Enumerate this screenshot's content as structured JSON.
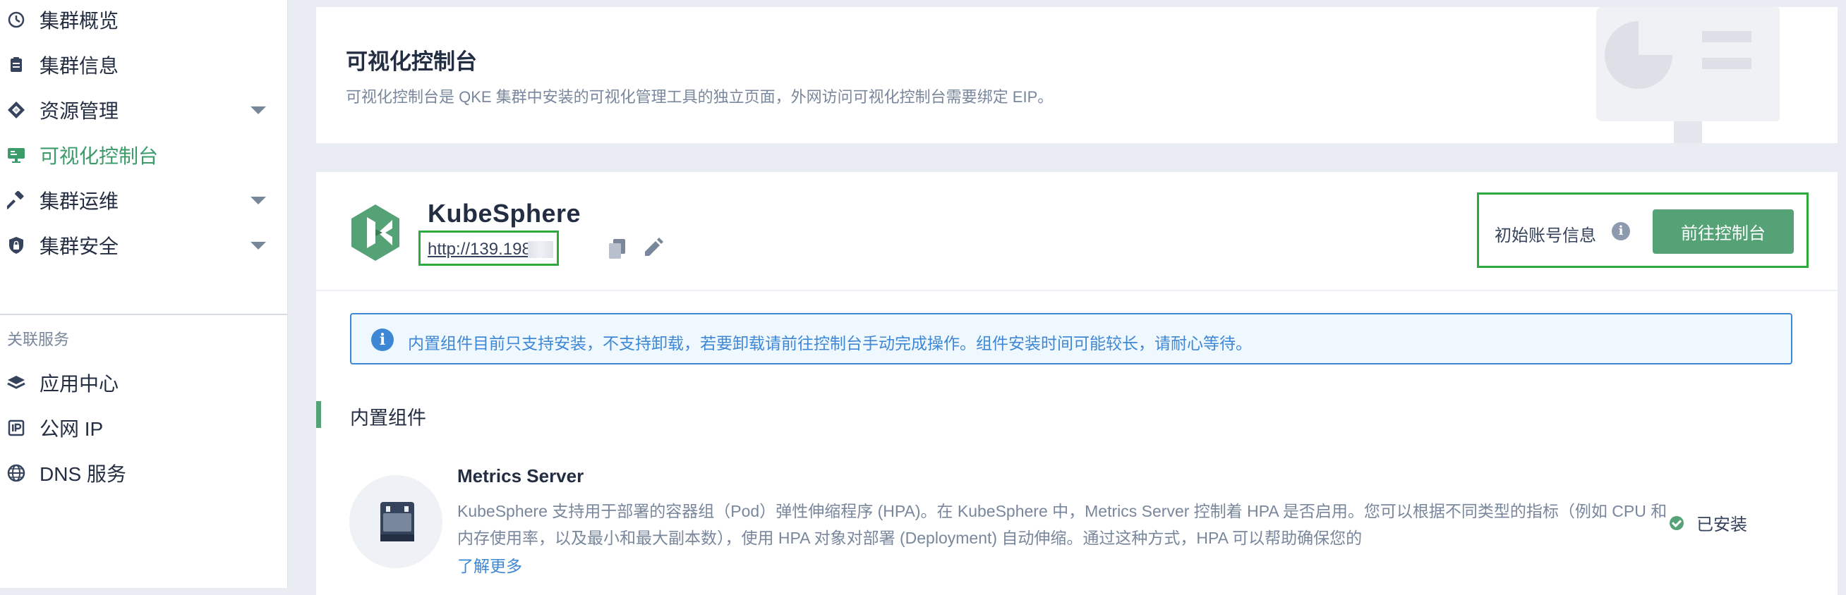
{
  "sidebar": {
    "items": [
      {
        "label": "集群概览",
        "icon": "dashboard-icon",
        "has_submenu": false,
        "active": false
      },
      {
        "label": "集群信息",
        "icon": "clipboard-icon",
        "has_submenu": false,
        "active": false
      },
      {
        "label": "资源管理",
        "icon": "resources-icon",
        "has_submenu": true,
        "active": false
      },
      {
        "label": "可视化控制台",
        "icon": "monitor-icon",
        "has_submenu": false,
        "active": true
      },
      {
        "label": "集群运维",
        "icon": "hammer-icon",
        "has_submenu": true,
        "active": false
      },
      {
        "label": "集群安全",
        "icon": "shield-lock-icon",
        "has_submenu": true,
        "active": false
      }
    ],
    "related_title": "关联服务",
    "related_items": [
      {
        "label": "应用中心",
        "icon": "layers-icon"
      },
      {
        "label": "公网 IP",
        "icon": "ip-icon"
      },
      {
        "label": "DNS 服务",
        "icon": "globe-icon"
      }
    ]
  },
  "header": {
    "title": "可视化控制台",
    "description": "可视化控制台是 QKE 集群中安装的可视化管理工具的独立页面，外网访问可视化控制台需要绑定 EIP。"
  },
  "console": {
    "app_name": "KubeSphere",
    "url": "http://139.198.",
    "account_label": "初始账号信息",
    "go_button": "前往控制台"
  },
  "notice": {
    "icon": "info-icon",
    "text": "内置组件目前只支持安装，不支持卸载，若要卸载请前往控制台手动完成操作。组件安装时间可能较长，请耐心等待。"
  },
  "builtin": {
    "title": "内置组件",
    "components": [
      {
        "name": "Metrics Server",
        "description": "KubeSphere 支持用于部署的容器组（Pod）弹性伸缩程序 (HPA)。在 KubeSphere 中，Metrics Server 控制着 HPA 是否启用。您可以根据不同类型的指标（例如 CPU 和内存使用率，以及最小和最大副本数），使用 HPA 对象对部署 (Deployment) 自动伸缩。通过这种方式，HPA 可以帮助确保您的",
        "learn_more": "了解更多",
        "status": "已安装"
      }
    ]
  },
  "colors": {
    "accent_green": "#55a277",
    "highlight_box": "#2fa83d",
    "info_blue": "#3e87d5",
    "text_dark": "#242e42",
    "text_muted": "#79879c"
  }
}
